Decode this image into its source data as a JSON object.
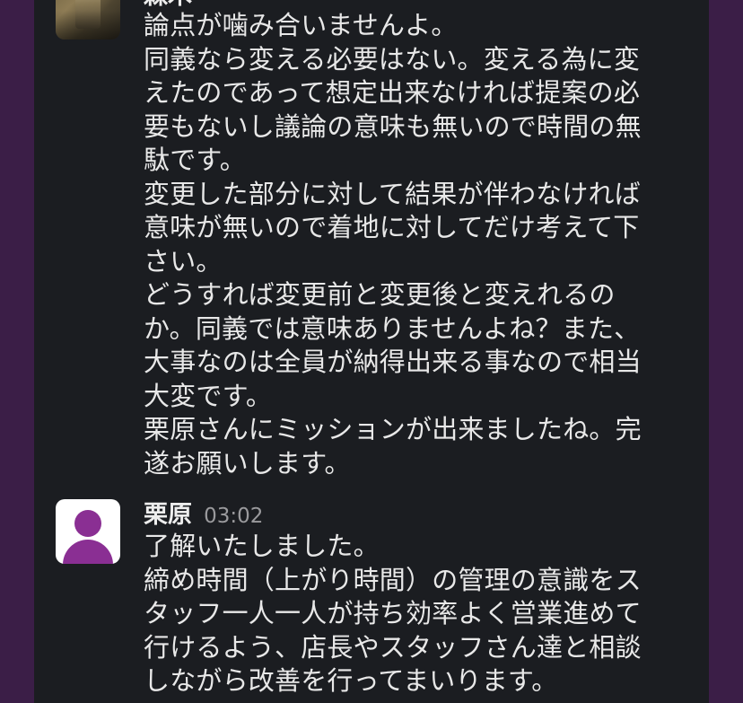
{
  "message1": {
    "username_partial": "森木",
    "lines": [
      "論点が噛み合いませんよ。",
      "同義なら変える必要はない。変える為に変",
      "えたのであって想定出来なければ提案の必",
      "要もないし議論の意味も無いので時間の無",
      "駄です。",
      "変更した部分に対して結果が伴わなければ",
      "意味が無いので着地に対してだけ考えて下",
      "さい。",
      "どうすれば変更前と変更後と変えれるの",
      "か。同義では意味ありませんよね？また、",
      "大事なのは全員が納得出来る事なので相当",
      "大変です。",
      "栗原さんにミッションが出来ましたね。完",
      "遂お願いします。"
    ]
  },
  "message2": {
    "username": "栗原",
    "time": "03:02",
    "lines": [
      "了解いたしました。",
      "締め時間（上がり時間）の管理の意識をス",
      "タッフ一人一人が持ち効率よく営業進めて",
      "行けるよう、店長やスタッフさん達と相談",
      "しながら改善を行ってまいります。"
    ]
  },
  "colors": {
    "background_chat": "#1b1d21",
    "sidebar_purple": "#3b1e47",
    "text": "#e8e8e8",
    "timestamp": "#9a9a9d",
    "avatar_accent": "#8a2f93"
  }
}
